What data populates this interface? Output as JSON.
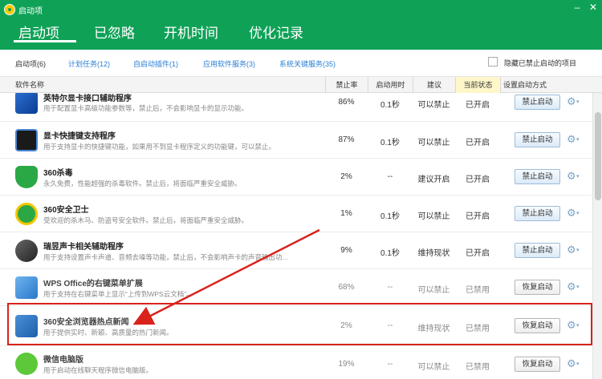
{
  "window": {
    "title": "启动项",
    "minimize": "–",
    "close": "✕"
  },
  "tabs": [
    {
      "label": "启动项"
    },
    {
      "label": "已忽略"
    },
    {
      "label": "开机时间"
    },
    {
      "label": "优化记录"
    }
  ],
  "subtabs": [
    {
      "label": "启动项(6)"
    },
    {
      "label": "计划任务(12)"
    },
    {
      "label": "自启动插件(1)"
    },
    {
      "label": "应用软件服务(3)"
    },
    {
      "label": "系统关键服务(35)"
    }
  ],
  "hide_disabled_label": "隐藏已禁止启动的项目",
  "columns": {
    "name": "软件名称",
    "disable_rate": "禁止率",
    "startup_time": "启动用时",
    "advice": "建议",
    "status": "当前状态",
    "setting": "设置启动方式"
  },
  "rows": [
    {
      "name": "英特尔显卡接口辅助程序",
      "desc": "用于配置显卡高级功能参数等，禁止后，不会影响显卡的显示功能。",
      "rate": "86%",
      "time": "0.1秒",
      "advice": "可以禁止",
      "status": "已开启",
      "action": "禁止启动",
      "icon": "intel-graphics-icon"
    },
    {
      "name": "显卡快捷键支持程序",
      "desc": "用于支持显卡的快捷键功能，如果用不到显卡程序定义的功能键，可以禁止。",
      "rate": "87%",
      "time": "0.1秒",
      "advice": "可以禁止",
      "status": "已开启",
      "action": "禁止启动",
      "icon": "monitor-icon"
    },
    {
      "name": "360杀毒",
      "desc": "永久免费，性能超强的杀毒软件。禁止后，将面临严重安全威胁。",
      "rate": "2%",
      "time": "--",
      "advice": "建议开启",
      "status": "已开启",
      "action": "禁止启动",
      "icon": "shield-icon"
    },
    {
      "name": "360安全卫士",
      "desc": "受欢迎的杀木马、防盗号安全软件。禁止后，将面临严重安全威胁。",
      "rate": "1%",
      "time": "0.1秒",
      "advice": "可以禁止",
      "status": "已开启",
      "action": "禁止启动",
      "icon": "360-safe-icon"
    },
    {
      "name": "瑞昱声卡相关辅助程序",
      "desc": "用于支持设置声卡声道、音频去噪等功能，禁止后，不会影响声卡的声音输出功...",
      "rate": "9%",
      "time": "0.1秒",
      "advice": "维持现状",
      "status": "已开启",
      "action": "禁止启动",
      "icon": "speaker-icon"
    },
    {
      "name": "WPS Office的右键菜单扩展",
      "desc": "用于支持在右键菜单上显示“上传到WPS云文档”。",
      "rate": "68%",
      "time": "--",
      "advice": "可以禁止",
      "status": "已禁用",
      "action": "恢复启动",
      "icon": "wps-cube-icon"
    },
    {
      "name": "360安全浏览器热点新闻",
      "desc": "用于提供实时、新颖、高质量的热门新闻。",
      "rate": "2%",
      "time": "--",
      "advice": "维持现状",
      "status": "已禁用",
      "action": "恢复启动",
      "icon": "news-icon"
    },
    {
      "name": "微信电脑版",
      "desc": "用于启动在线聊天程序微信电脑版。",
      "rate": "19%",
      "time": "--",
      "advice": "可以禁止",
      "status": "已禁用",
      "action": "恢复启动",
      "icon": "wechat-icon"
    }
  ],
  "colors": {
    "brand": "#0fa257",
    "annotation": "#d9221c",
    "link": "#2a7fd4"
  }
}
